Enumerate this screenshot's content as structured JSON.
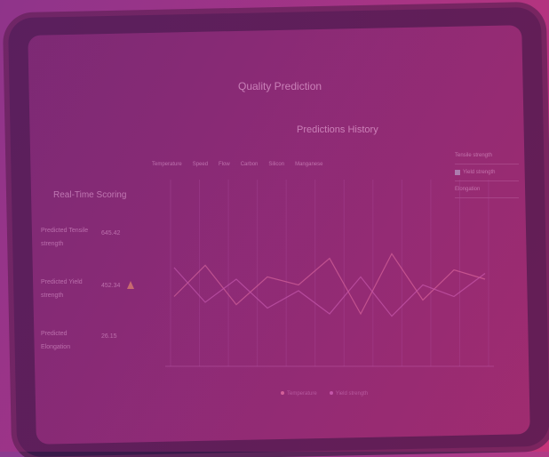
{
  "app": {
    "title": "Quality Prediction"
  },
  "history": {
    "title": "Predictions History",
    "tabs": [
      "Temperature",
      "Speed",
      "Flow",
      "Carbon",
      "Silicon",
      "Manganese"
    ]
  },
  "legend_right": [
    {
      "label": "Tensile strength",
      "checked": false
    },
    {
      "label": "Yield strength",
      "checked": true
    },
    {
      "label": "Elongation",
      "checked": false
    }
  ],
  "scoring": {
    "title": "Real-Time Scoring",
    "metrics": [
      {
        "label_line1": "Predicted Tensile",
        "label_line2": "strength",
        "value": "645.42",
        "warning": false
      },
      {
        "label_line1": "Predicted Yield",
        "label_line2": "strength",
        "value": "452.34",
        "warning": true
      },
      {
        "label_line1": "Predicted",
        "label_line2": "Elongation",
        "value": "26.15",
        "warning": false
      }
    ]
  },
  "chart_data": {
    "type": "line",
    "series": [
      {
        "values": [
          0.45,
          0.72,
          0.38,
          0.62,
          0.55,
          0.78,
          0.3,
          0.82,
          0.42,
          0.68,
          0.6
        ]
      },
      {
        "values": [
          0.7,
          0.4,
          0.6,
          0.35,
          0.5,
          0.3,
          0.62,
          0.28,
          0.55,
          0.45,
          0.65
        ]
      }
    ],
    "colors": [
      "#e07aa8",
      "#c86ac0"
    ],
    "grid": true
  },
  "bottom_legend": [
    {
      "label": "Temperature",
      "color": "#e07aa8"
    },
    {
      "label": "Yield strength",
      "color": "#c86ac0"
    }
  ]
}
